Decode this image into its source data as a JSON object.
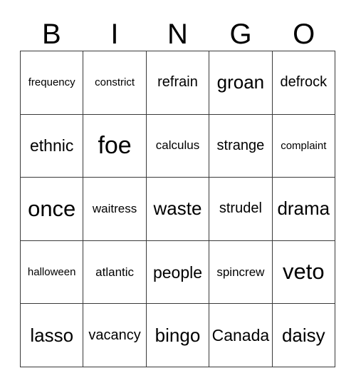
{
  "header": {
    "letters": [
      "B",
      "I",
      "N",
      "G",
      "O"
    ]
  },
  "grid": {
    "columns": 5,
    "rows": 5,
    "cells": [
      "frequency",
      "constrict",
      "refrain",
      "groan",
      "defrock",
      "ethnic",
      "foe",
      "calculus",
      "strange",
      "complaint",
      "once",
      "waitress",
      "waste",
      "strudel",
      "drama",
      "halloween",
      "atlantic",
      "people",
      "spincrew",
      "veto",
      "lasso",
      "vacancy",
      "bingo",
      "Canada",
      "daisy"
    ]
  },
  "colors": {
    "background": "#ffffff",
    "text": "#000000",
    "border": "#3a3a3a"
  }
}
